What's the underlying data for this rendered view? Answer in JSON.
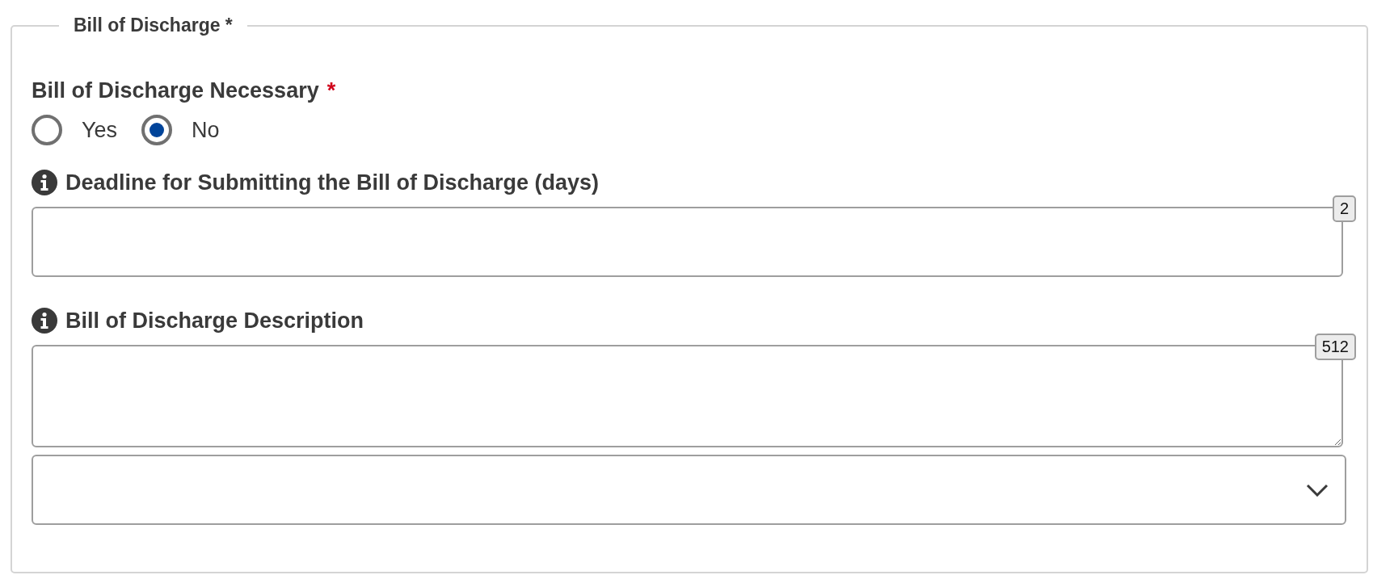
{
  "fieldset": {
    "legend": "Bill of Discharge *"
  },
  "necessary": {
    "label": "Bill of Discharge Necessary",
    "required_mark": "*",
    "options": [
      {
        "label": "Yes",
        "selected": false
      },
      {
        "label": "No",
        "selected": true
      }
    ]
  },
  "fields": [
    {
      "kind": "input",
      "label": "Deadline for Submitting the Bill of Discharge (days)",
      "counter": "2"
    },
    {
      "kind": "textarea",
      "label": "Bill of Discharge Description",
      "counter": "512"
    },
    {
      "kind": "select"
    }
  ]
}
